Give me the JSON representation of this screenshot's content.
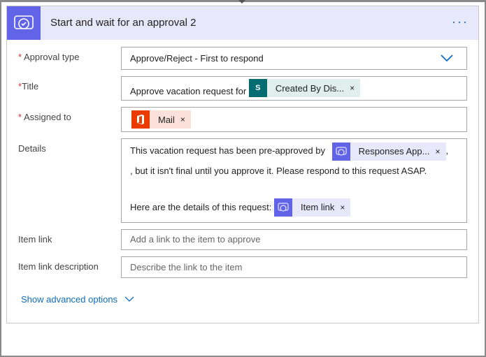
{
  "header": {
    "title": "Start and wait for an approval 2",
    "icon": "approval-icon",
    "more": "···"
  },
  "fields": {
    "approval_type": {
      "label": "Approval type",
      "required": "*",
      "value": "Approve/Reject - First to respond"
    },
    "title": {
      "label": "Title",
      "required": "*",
      "text": "Approve vacation request for",
      "token": "Created By Dis...",
      "token_icon": "S"
    },
    "assigned_to": {
      "label": "Assigned to",
      "required": "*",
      "token": "Mail"
    },
    "details": {
      "label": "Details",
      "line1": "This vacation request has been pre-approved by",
      "token1": "Responses App...",
      "comma": ",",
      "line2": ", but it isn't final until you approve it. Please respond to this request ASAP.",
      "line3": "Here are the details of this request:",
      "token2": "Item link"
    },
    "item_link": {
      "label": "Item link",
      "placeholder": "Add a link to the item to approve"
    },
    "item_link_description": {
      "label": "Item link description",
      "placeholder": "Describe the link to the item"
    }
  },
  "show_advanced": "Show advanced options",
  "remove_glyph": "×",
  "colors": {
    "accent": "#6264e8",
    "link": "#0f6cbd",
    "required": "#d13438"
  }
}
